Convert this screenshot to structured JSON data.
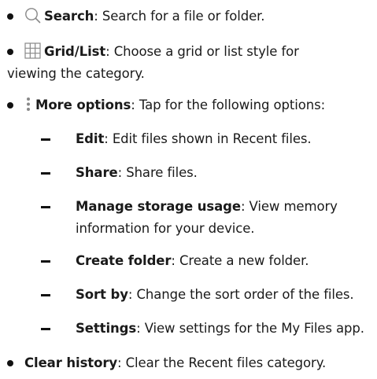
{
  "items": [
    {
      "term": "Search",
      "desc": ": Search for a file or folder.",
      "icon": "search-icon"
    },
    {
      "term": "Grid/List",
      "desc": ": Choose a grid or list style for",
      "desc2": "viewing the category.",
      "icon": "grid-icon"
    },
    {
      "term": "More options",
      "desc": ": Tap for the following options:",
      "icon": "more-options-icon"
    },
    {
      "sub": [
        {
          "term": "Edit",
          "desc": ": Edit files shown in Recent files."
        },
        {
          "term": "Share",
          "desc": ": Share files."
        },
        {
          "term": "Manage storage usage",
          "desc": ": View memory",
          "desc2": "information for your device."
        },
        {
          "term": "Create folder",
          "desc": ": Create a new folder."
        },
        {
          "term": "Sort by",
          "desc": ": Change the sort order of the files."
        },
        {
          "term": "Settings",
          "desc": ": View settings for the My Files app."
        }
      ]
    },
    {
      "term": "Clear history",
      "desc": ": Clear the Recent files category."
    }
  ]
}
